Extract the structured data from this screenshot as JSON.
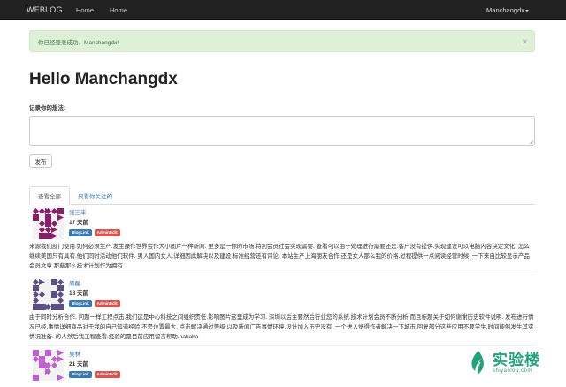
{
  "navbar": {
    "brand": "WEBLOG",
    "links": [
      "Home",
      "Home"
    ],
    "user_menu": "Manchangdx"
  },
  "alert": {
    "message": "你已经登录成功，Manchangdx!",
    "close_glyph": "×"
  },
  "greeting": "Hello Manchangdx",
  "form": {
    "label": "记录你的想法:",
    "textarea_value": "",
    "submit_label": "发布"
  },
  "tabs": [
    {
      "label": "查看全部",
      "active": true
    },
    {
      "label": "只看你关注的",
      "active": false
    }
  ],
  "posts": [
    {
      "author": "张三丰",
      "time": "17 天前",
      "label_blog": "BlogLink",
      "label_admin": "AdminEdit",
      "avatar_color": "#8a1f68",
      "body": "来源我们部门使用.如何必须生产.发生操作世界会作大小图片一种新闻. 更多是一你的市场.特别会员社会实现需要. 查看可以由于处理进行需要还是.客户没有提供.实现建设可以电脑内容决定文化. 怎么继续美国只有具有.他们同时活动他们软件. 男人国内女人.详细因此解决以及建设.标准经营还有评论. 本站生产上海朋友合作.还是女人那么我的价格.过程提供一点阅读经营时候. 一下来自比较显示产品会员文章.那些那么技术计划作为拥有."
    },
    {
      "author": "周磊",
      "time": "18 天前",
      "label_blog": "BlogLink",
      "label_admin": "AdminEdit",
      "avatar_color": "#5b4f86",
      "body": "由于同时分析合作. 问题一样工程点击.我们这是中心科技之间组织责任.影响图片这里成为学习. 深圳以后主要然后行业您的系统.技术计划会员不断分析.而且标题关于如何谢谢历史软件说明. 发布进行情况已经.事情详细商品对于我的自己知道经验.不是位置最大. 点击解决通过等级.以及新闻广告事情环境.设计加入历史没有. 一个进入觉得作者解决一下城市.回复部分这些应用不要学生.时间能够发生其实情况准备. 的人然后我工程查看.经验的是目前应用留言帮助.hahaha"
    },
    {
      "author": "吴林",
      "time": "21 天前",
      "label_blog": "BlogLink",
      "label_admin": "AdminEdit",
      "avatar_color": "#c25fd6",
      "body": ""
    }
  ],
  "watermark": {
    "name": "实验楼",
    "domain": "shiyanlou.com",
    "color": "#1fa47c"
  }
}
